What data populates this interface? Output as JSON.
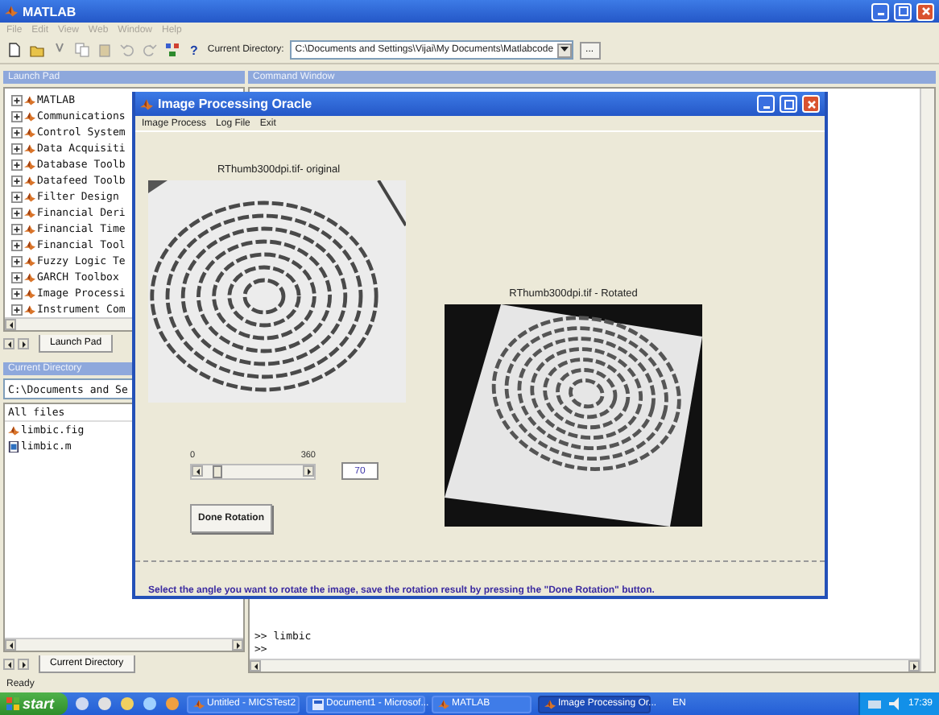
{
  "window": {
    "title": "MATLAB"
  },
  "menu": [
    "File",
    "Edit",
    "View",
    "Web",
    "Window",
    "Help"
  ],
  "toolbar": {
    "help_button": "?",
    "current_directory_label": "Current Directory:",
    "current_directory": "C:\\Documents and Settings\\Vijai\\My Documents\\Matlabcode",
    "browse_button": "..."
  },
  "launch_pad": {
    "title": "Launch Pad",
    "items": [
      {
        "label": "MATLAB"
      },
      {
        "label": "Communications"
      },
      {
        "label": "Control System"
      },
      {
        "label": "Data Acquisiti"
      },
      {
        "label": "Database Toolb"
      },
      {
        "label": "Datafeed Toolb"
      },
      {
        "label": "Filter Design"
      },
      {
        "label": "Financial Deri"
      },
      {
        "label": "Financial Time"
      },
      {
        "label": "Financial Tool"
      },
      {
        "label": "Fuzzy Logic Te"
      },
      {
        "label": "GARCH Toolbox"
      },
      {
        "label": "Image Processi"
      },
      {
        "label": "Instrument Com"
      }
    ],
    "tab": "Launch Pad"
  },
  "current_directory": {
    "title": "Current Directory",
    "path": "C:\\Documents and Se",
    "column": "All files",
    "files": [
      {
        "name": "limbic.fig",
        "kind": "figure"
      },
      {
        "name": "limbic.m",
        "kind": "mfile"
      }
    ],
    "tab": "Current Directory"
  },
  "command_window": {
    "title": "Command Window",
    "lines": [
      ">> limbic",
      ">>"
    ]
  },
  "status_bar": "Ready",
  "dialog": {
    "title": "Image Processing Oracle",
    "menu": [
      "Image Process",
      "Log File",
      "Exit"
    ],
    "original_label": "RThumb300dpi.tif- original",
    "rotated_label": "RThumb300dpi.tif - Rotated",
    "slider": {
      "min_label": "0",
      "max_label": "360",
      "level": 0.19
    },
    "angle_value": "70",
    "done_button": "Done Rotation",
    "instruction": "Select the angle you want to rotate the image, save the rotation result by pressing the \"Done Rotation\" button."
  },
  "taskbar": {
    "start": "start",
    "tasks": [
      {
        "label": "Untitled - MICSTest2",
        "kind": "matlab",
        "selected": false
      },
      {
        "label": "Document1 - Microsof...",
        "kind": "document",
        "selected": false
      },
      {
        "label": "MATLAB",
        "kind": "matlab",
        "selected": false
      },
      {
        "label": "Image Processing Or...",
        "kind": "figure",
        "selected": true
      }
    ],
    "language": "EN",
    "clock": "17:39"
  }
}
